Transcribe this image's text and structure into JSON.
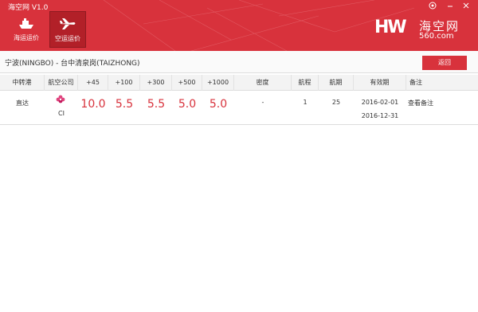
{
  "app": {
    "title": "海空网 V1.0"
  },
  "header": {
    "tabs": [
      {
        "label": "海运运价",
        "icon": "ship-icon"
      },
      {
        "label": "空运运价",
        "icon": "plane-icon",
        "active": true
      }
    ],
    "logo": {
      "mark": "HW",
      "cn": "海空网",
      "sub": "560.com"
    },
    "controls": [
      "settings-icon",
      "minimize-icon",
      "close-icon"
    ]
  },
  "route": {
    "text": "宁波(NINGBO) - 台中清泉岗(TAIZHONG)",
    "back_label": "返回"
  },
  "table": {
    "headers": [
      "中转港",
      "航空公司",
      "+45",
      "+100",
      "+300",
      "+500",
      "+1000",
      "密度",
      "航程",
      "航期",
      "有效期",
      "备注"
    ],
    "rows": [
      {
        "transit": "直达",
        "airline_code": "CI",
        "prices": [
          "10.0",
          "5.5",
          "5.5",
          "5.0",
          "5.0"
        ],
        "density": "-",
        "legs": "1",
        "schedule": "25",
        "valid_from": "2016-02-01",
        "valid_to": "2016-12-31",
        "note": "查看备注"
      }
    ]
  },
  "colors": {
    "brand": "#d8323c",
    "price": "#d8323c"
  }
}
